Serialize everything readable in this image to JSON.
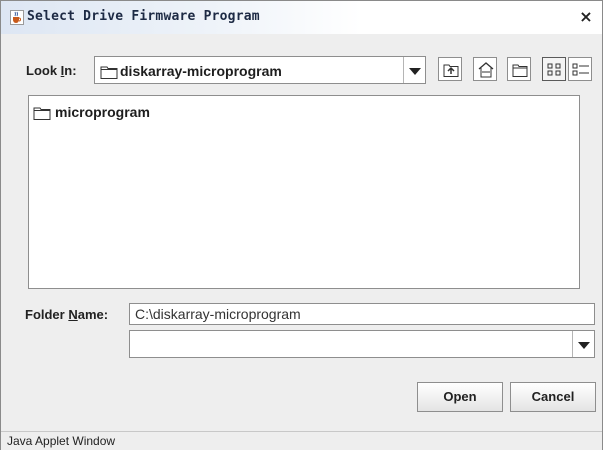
{
  "window": {
    "title": "Select Drive Firmware Program",
    "close_glyph": "×"
  },
  "look_in": {
    "label": "Look In:",
    "label_before": "Look ",
    "label_mnemonic": "I",
    "label_after": "n:",
    "selected": "diskarray-microprogram"
  },
  "toolbar": {
    "buttons": [
      {
        "name": "up-one-level",
        "icon": "folder-up-icon"
      },
      {
        "name": "home",
        "icon": "home-icon"
      },
      {
        "name": "new-folder",
        "icon": "new-folder-icon"
      },
      {
        "name": "list-view",
        "icon": "list-view-icon"
      },
      {
        "name": "details-view",
        "icon": "details-view-icon"
      }
    ]
  },
  "file_list": {
    "items": [
      {
        "label": "microprogram",
        "icon": "folder-icon"
      }
    ]
  },
  "folder_name": {
    "label": "Folder Name:",
    "label_before": "Folder ",
    "label_mnemonic": "N",
    "label_after": "ame:",
    "value": "C:\\diskarray-microprogram"
  },
  "file_type": {
    "selected": ""
  },
  "buttons": {
    "open": "Open",
    "cancel": "Cancel"
  },
  "status": {
    "text": "Java Applet Window"
  },
  "colors": {
    "window_bg": "#eeeeee",
    "title_text": "#1d2a44",
    "field_bg": "#ffffff",
    "border": "#8e8e8e"
  }
}
